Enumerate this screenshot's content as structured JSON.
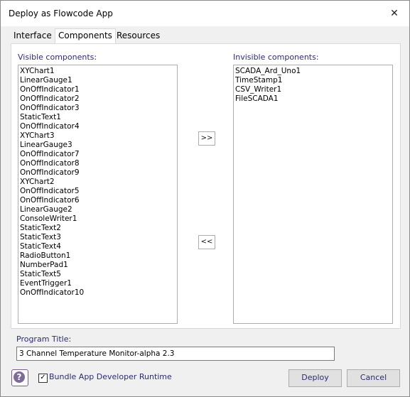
{
  "window": {
    "title": "Deploy as Flowcode App",
    "close_glyph": "✕"
  },
  "tabs": [
    {
      "label": "Interface"
    },
    {
      "label": "Components"
    },
    {
      "label": "Resources"
    }
  ],
  "visible": {
    "label": "Visible components:",
    "items": [
      "XYChart1",
      "LinearGauge1",
      "OnOffIndicator1",
      "OnOffIndicator2",
      "OnOffIndicator3",
      "StaticText1",
      "OnOffIndicator4",
      "XYChart3",
      "LinearGauge3",
      "OnOffIndicator7",
      "OnOffIndicator8",
      "OnOffIndicator9",
      "XYChart2",
      "OnOffIndicator5",
      "OnOffIndicator6",
      "LinearGauge2",
      "ConsoleWriter1",
      "StaticText2",
      "StaticText3",
      "StaticText4",
      "RadioButton1",
      "NumberPad1",
      "StaticText5",
      "EventTrigger1",
      "OnOffIndicator10"
    ]
  },
  "invisible": {
    "label": "Invisible components:",
    "items": [
      "SCADA_Ard_Uno1",
      "TimeStamp1",
      "CSV_Writer1",
      "FileSCADA1"
    ]
  },
  "move": {
    "to_invisible": ">>",
    "to_visible": "<<"
  },
  "program_title": {
    "label": "Program Title:",
    "value": "3 Channel Temperature Monitor-alpha 2.3"
  },
  "footer": {
    "help_glyph": "?",
    "bundle_label": "Bundle App Developer Runtime",
    "bundle_checked": true,
    "check_glyph": "✓",
    "deploy_label": "Deploy",
    "cancel_label": "Cancel"
  }
}
